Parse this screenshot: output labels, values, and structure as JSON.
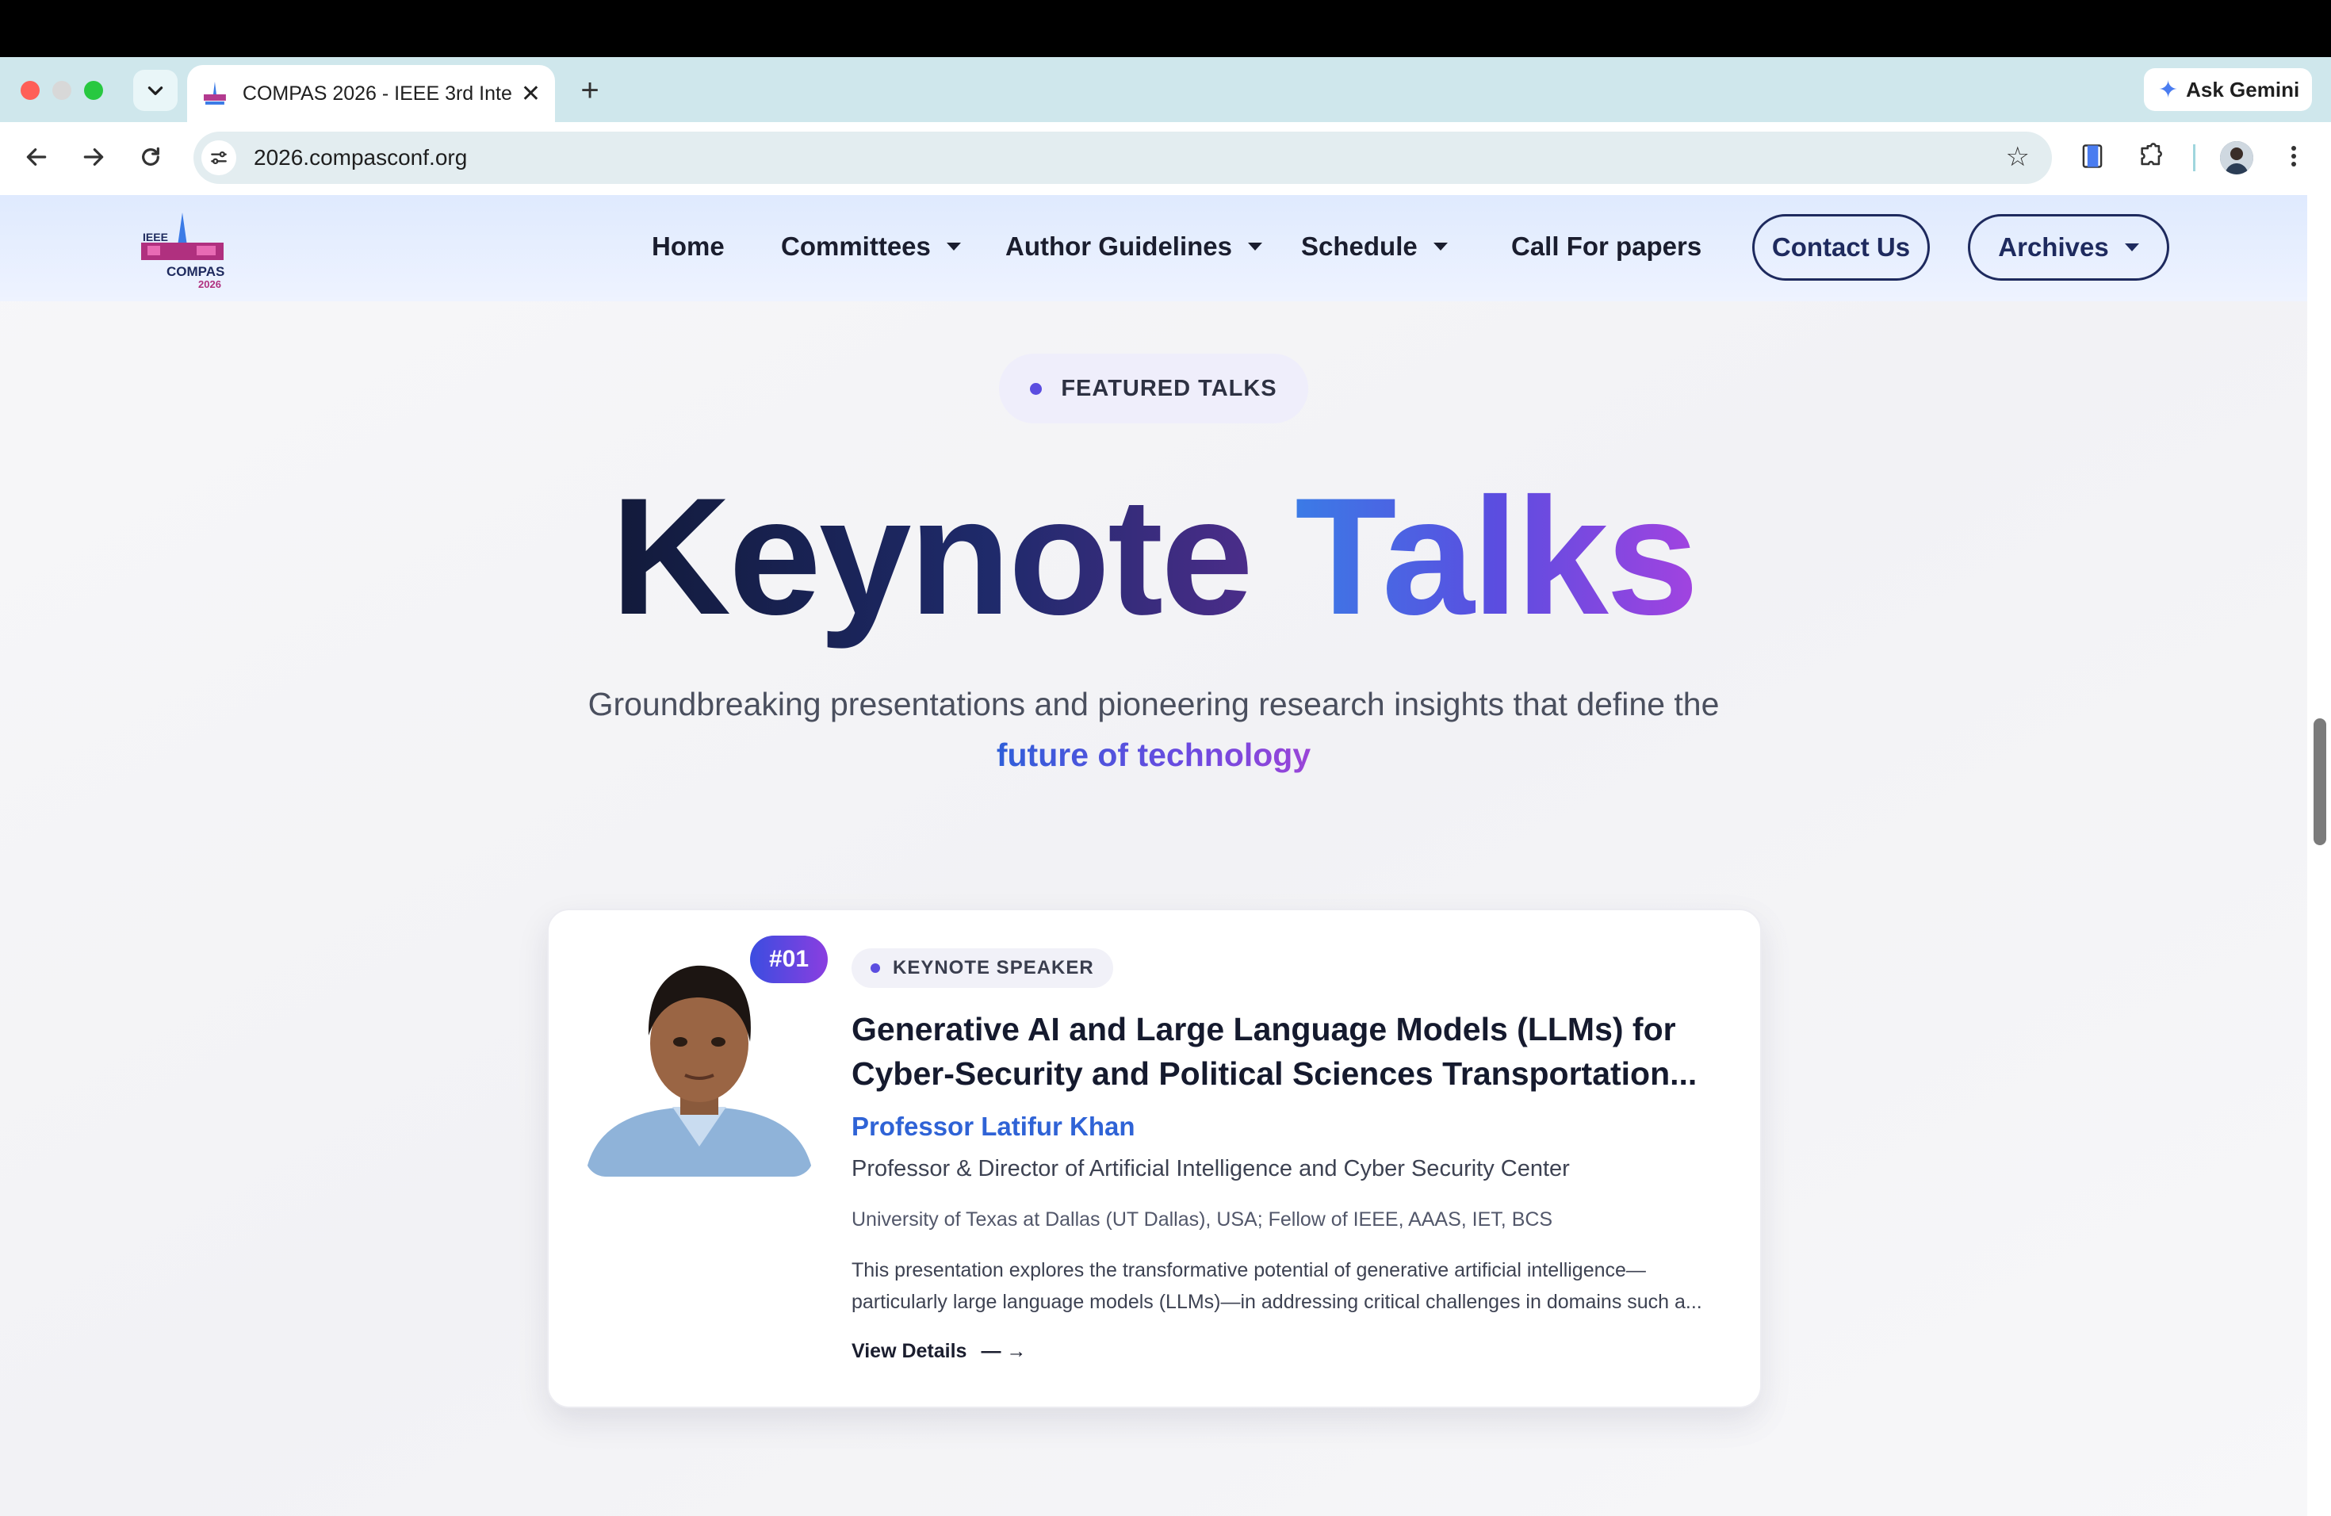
{
  "browser": {
    "tab": {
      "title": "COMPAS 2026 - IEEE 3rd Inte"
    },
    "url": "2026.compasconf.org",
    "ask_gemini": "Ask Gemini"
  },
  "site": {
    "logo": {
      "text_top": "IEEE",
      "text_main": "COMPAS",
      "text_year": "2026"
    },
    "nav": [
      {
        "label": "Home",
        "has_dropdown": false
      },
      {
        "label": "Committees",
        "has_dropdown": true
      },
      {
        "label": "Author Guidelines",
        "has_dropdown": true
      },
      {
        "label": "Schedule",
        "has_dropdown": true
      },
      {
        "label": "Call For papers",
        "has_dropdown": false
      }
    ],
    "contact_button": "Contact Us",
    "archives_button": "Archives"
  },
  "hero": {
    "badge": "FEATURED TALKS",
    "title_part1": "Keynote",
    "title_part2": "Talks",
    "subtitle": "Groundbreaking presentations and pioneering research insights that define the",
    "subtitle_accent": "future of technology"
  },
  "keynotes": [
    {
      "number": "#01",
      "tag": "KEYNOTE SPEAKER",
      "title": "Generative AI and Large Language Models (LLMs) for Cyber-Security and Political Sciences Transportation...",
      "speaker": "Professor Latifur Khan",
      "role": "Professor & Director of Artificial Intelligence and Cyber Security Center",
      "affiliation": "University of Texas at Dallas (UT Dallas), USA; Fellow of IEEE, AAAS, IET, BCS",
      "description": "This presentation explores the transformative potential of generative artificial intelligence—particularly large language models (LLMs)—in addressing critical challenges in domains such a...",
      "link_label": "View Details",
      "link_arrow": "— →"
    }
  ],
  "colors": {
    "accent_blue": "#2f63d6",
    "accent_purple": "#5b4de0",
    "nav_dark": "#1e2a5e",
    "tabstrip": "#cfe7ec"
  }
}
